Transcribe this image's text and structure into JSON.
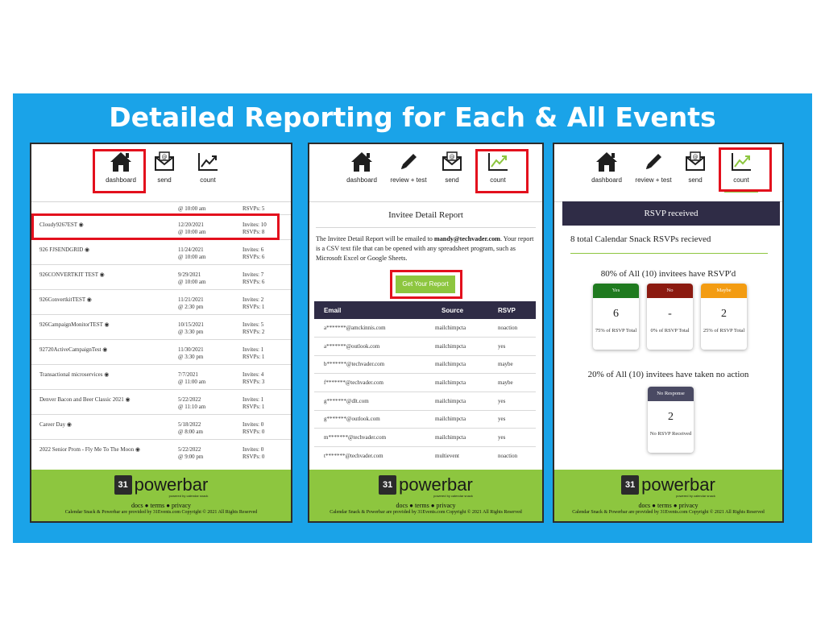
{
  "slide_title": "Detailed Reporting for Each & All Events",
  "nav": {
    "dashboard": "dashboard",
    "review_test": "review + test",
    "send": "send",
    "count": "count"
  },
  "events": [
    {
      "name": "",
      "date": "",
      "time": "@ 10:00 am",
      "invites": "",
      "rsvps": "RSVPs: 5"
    },
    {
      "name": "Cloudy9267EST ◉",
      "date": "12/20/2021",
      "time": "@ 10:00 am",
      "invites": "Invites: 10",
      "rsvps": "RSVPs: 8"
    },
    {
      "name": "926 FJSENDGRID ◉",
      "date": "11/24/2021",
      "time": "@ 10:00 am",
      "invites": "Invites: 6",
      "rsvps": "RSVPs: 6"
    },
    {
      "name": "926CONVERTKIT TEST ◉",
      "date": "9/29/2021",
      "time": "@ 10:00 am",
      "invites": "Invites: 7",
      "rsvps": "RSVPs: 6"
    },
    {
      "name": "926ConvertkitTEST ◉",
      "date": "11/21/2021",
      "time": "@ 2:30 pm",
      "invites": "Invites: 2",
      "rsvps": "RSVPs: 1"
    },
    {
      "name": "926CampaignMonitorTEST ◉",
      "date": "10/15/2021",
      "time": "@ 3:30 pm",
      "invites": "Invites: 5",
      "rsvps": "RSVPs: 2"
    },
    {
      "name": "92720ActiveCampaignTest ◉",
      "date": "11/30/2021",
      "time": "@ 3:30 pm",
      "invites": "Invites: 1",
      "rsvps": "RSVPs: 1"
    },
    {
      "name": "Transactional microservices ◉",
      "date": "7/7/2021",
      "time": "@ 11:00 am",
      "invites": "Invites: 4",
      "rsvps": "RSVPs: 3"
    },
    {
      "name": "Denver Bacon and Beer Classic 2021 ◉",
      "date": "5/22/2022",
      "time": "@ 11:10 am",
      "invites": "Invites: 1",
      "rsvps": "RSVPs: 1"
    },
    {
      "name": "Career Day ◉",
      "date": "5/18/2022",
      "time": "@ 8:00 am",
      "invites": "Invites: 0",
      "rsvps": "RSVPs: 0"
    },
    {
      "name": "2022 Senior Prom - Fly Me To The Moon ◉",
      "date": "5/22/2022",
      "time": "@ 9:00 pm",
      "invites": "Invites: 0",
      "rsvps": "RSVPs: 0"
    }
  ],
  "footer": {
    "logo_badge": "31",
    "logo_text": "powerbar",
    "logo_sub": "powered by calendar snack",
    "links": "docs ● terms ● privacy",
    "copyright": "Calendar Snack & Powerbar are provided by 31Events.com Copyright © 2021 All Rights Reserved"
  },
  "report": {
    "title": "Invitee Detail Report",
    "desc_prefix": "The Invitee Detail Report will be emailed to ",
    "desc_email": "mandy@techvader.com",
    "desc_suffix": ". Your report is a CSV text file that can be opened with any spreadsheet program, such as Microsoft Excel or Google Sheets.",
    "button": "Get Your Report",
    "headers": {
      "email": "Email",
      "source": "Source",
      "rsvp": "RSVP"
    },
    "rows": [
      {
        "email": "a*******@amckinnis.com",
        "source": "mailchimpcta",
        "rsvp": "noaction"
      },
      {
        "email": "a*******@outlook.com",
        "source": "mailchimpcta",
        "rsvp": "yes"
      },
      {
        "email": "b*******@techvader.com",
        "source": "mailchimpcta",
        "rsvp": "maybe"
      },
      {
        "email": "f*******@techvader.com",
        "source": "mailchimpcta",
        "rsvp": "maybe"
      },
      {
        "email": "g*******@dlt.com",
        "source": "mailchimpcta",
        "rsvp": "yes"
      },
      {
        "email": "g*******@outlook.com",
        "source": "mailchimpcta",
        "rsvp": "yes"
      },
      {
        "email": "m*******@techvader.com",
        "source": "mailchimpcta",
        "rsvp": "yes"
      },
      {
        "email": "t*******@techvader.com",
        "source": "multievent",
        "rsvp": "noaction"
      }
    ]
  },
  "rsvp": {
    "header": "RSVP received",
    "total": "8 total  Calendar Snack RSVPs recieved",
    "pct_rsvpd": "80% of All (10) invitees have RSVP'd",
    "cards": [
      {
        "label": "Yes",
        "value": "6",
        "pct": "75% of RSVP Total",
        "color": "#1f7a1f"
      },
      {
        "label": "No",
        "value": "-",
        "pct": "0% of RSVP Total",
        "color": "#8b1a10"
      },
      {
        "label": "Maybe",
        "value": "2",
        "pct": "25% of RSVP Total",
        "color": "#f39c12"
      }
    ],
    "pct_noaction": "20% of All (10) invitees have taken no action",
    "no_response": {
      "label": "No Response",
      "value": "2",
      "pct": "No RSVP Received",
      "color": "#4a4a63"
    }
  },
  "colors": {
    "accent_green": "#8dc63f",
    "highlight_red": "#e3101d",
    "slide_blue": "#1aa3e8",
    "table_dark": "#2f2c46"
  }
}
